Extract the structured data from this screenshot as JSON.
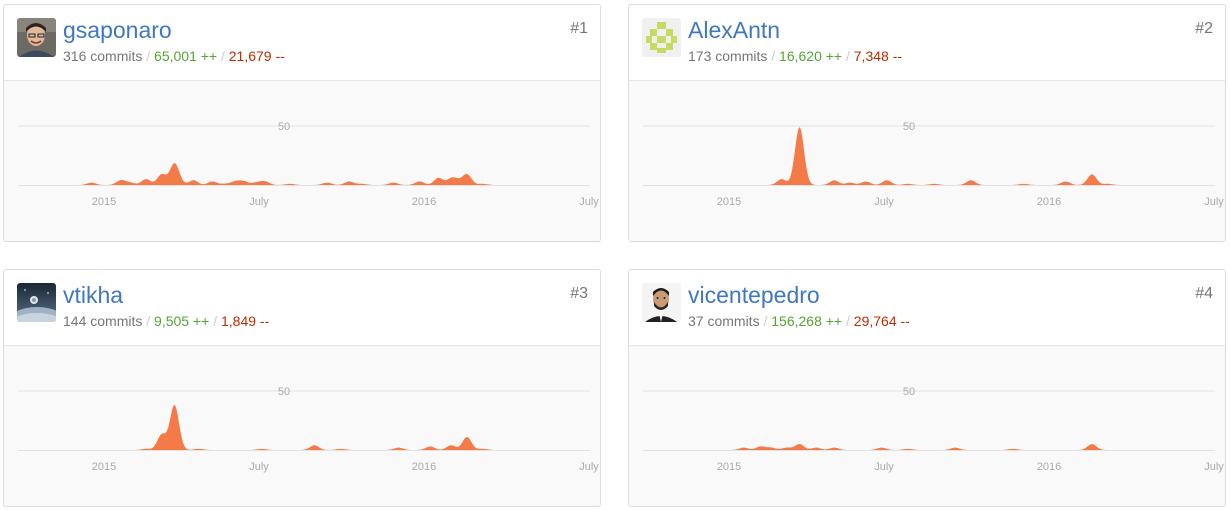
{
  "colors": {
    "area": "#f47b48",
    "link": "#4078c0",
    "additions": "#55a532",
    "deletions": "#bd2c00"
  },
  "chart_common": {
    "x_ticks": [
      "2015",
      "July",
      "2016",
      "July"
    ],
    "y_gridline": "50"
  },
  "contributors": [
    {
      "username": "gsaponaro",
      "rank": "#1",
      "commits": "316 commits",
      "additions": "65,001 ++",
      "deletions": "21,679 --",
      "avatar_icon": "portrait-photo-icon",
      "peaks": [
        [
          -12,
          2
        ],
        [
          16,
          4
        ],
        [
          25,
          2
        ],
        [
          40,
          5
        ],
        [
          55,
          9
        ],
        [
          67,
          18
        ],
        [
          72,
          1
        ],
        [
          85,
          4
        ],
        [
          103,
          3
        ],
        [
          115,
          1
        ],
        [
          125,
          3
        ],
        [
          133,
          3
        ],
        [
          145,
          2
        ],
        [
          153,
          3
        ],
        [
          177,
          1
        ],
        [
          212,
          2
        ],
        [
          233,
          3
        ],
        [
          245,
          1
        ],
        [
          275,
          2
        ],
        [
          300,
          3
        ],
        [
          318,
          6
        ],
        [
          330,
          5
        ],
        [
          336,
          3
        ],
        [
          345,
          9
        ],
        [
          360,
          1
        ]
      ]
    },
    {
      "username": "AlexAntn",
      "rank": "#2",
      "commits": "173 commits",
      "additions": "16,620 ++",
      "deletions": "7,348 --",
      "avatar_icon": "identicon-icon",
      "peaks": [
        [
          50,
          5
        ],
        [
          67,
          49
        ],
        [
          100,
          4
        ],
        [
          115,
          2
        ],
        [
          130,
          3
        ],
        [
          150,
          4
        ],
        [
          170,
          1
        ],
        [
          195,
          1
        ],
        [
          230,
          4
        ],
        [
          280,
          1
        ],
        [
          320,
          3
        ],
        [
          345,
          9
        ],
        [
          360,
          1
        ]
      ]
    },
    {
      "username": "vtikha",
      "rank": "#3",
      "commits": "144 commits",
      "additions": "9,505 ++",
      "deletions": "1,849 --",
      "avatar_icon": "space-photo-icon",
      "peaks": [
        [
          40,
          1
        ],
        [
          55,
          13
        ],
        [
          67,
          38
        ],
        [
          90,
          1
        ],
        [
          150,
          1
        ],
        [
          200,
          4
        ],
        [
          225,
          1
        ],
        [
          280,
          2
        ],
        [
          310,
          3
        ],
        [
          330,
          4
        ],
        [
          345,
          11
        ],
        [
          360,
          1
        ]
      ]
    },
    {
      "username": "vicentepedro",
      "rank": "#4",
      "commits": "37 commits",
      "additions": "156,268 ++",
      "deletions": "29,764 --",
      "avatar_icon": "portrait-photo-icon",
      "peaks": [
        [
          14,
          2
        ],
        [
          30,
          3
        ],
        [
          40,
          2
        ],
        [
          55,
          2
        ],
        [
          67,
          5
        ],
        [
          83,
          2
        ],
        [
          100,
          2
        ],
        [
          145,
          2
        ],
        [
          170,
          1
        ],
        [
          215,
          2
        ],
        [
          270,
          1
        ],
        [
          345,
          5
        ]
      ]
    }
  ]
}
